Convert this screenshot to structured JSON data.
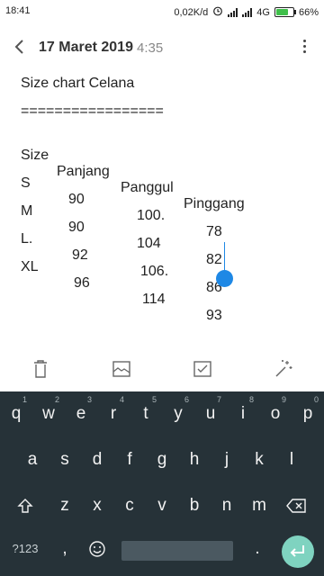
{
  "status_bar": {
    "time": "18:41",
    "network_speed": "0,02K/d",
    "network_type": "4G",
    "battery": "66%",
    "battery_level": 0.66
  },
  "header": {
    "date": "17 Maret 2019",
    "time": "4:35"
  },
  "note": {
    "title": "Size chart Celana",
    "separator": "=================",
    "columns": [
      "Size",
      "Panjang",
      "Panggul",
      "Pinggang"
    ],
    "rows": [
      [
        "S",
        "90",
        "100.",
        "78"
      ],
      [
        "M",
        "90",
        "104",
        "82"
      ],
      [
        "L.",
        "92",
        "106.",
        "86"
      ],
      [
        "XL",
        "96",
        "114",
        "93"
      ]
    ]
  },
  "toolbar": {
    "items": [
      "delete-icon",
      "image-icon",
      "checklist-icon",
      "magic-icon"
    ]
  },
  "keyboard": {
    "row1": [
      {
        "key": "q",
        "hint": "1"
      },
      {
        "key": "w",
        "hint": "2"
      },
      {
        "key": "e",
        "hint": "3"
      },
      {
        "key": "r",
        "hint": "4"
      },
      {
        "key": "t",
        "hint": "5"
      },
      {
        "key": "y",
        "hint": "6"
      },
      {
        "key": "u",
        "hint": "7"
      },
      {
        "key": "i",
        "hint": "8"
      },
      {
        "key": "o",
        "hint": "9"
      },
      {
        "key": "p",
        "hint": "0"
      }
    ],
    "row2": [
      "a",
      "s",
      "d",
      "f",
      "g",
      "h",
      "j",
      "k",
      "l"
    ],
    "row3": [
      "z",
      "x",
      "c",
      "v",
      "b",
      "n",
      "m"
    ],
    "symbols_label": "?123",
    "comma": ",",
    "period": "."
  },
  "colors": {
    "accent": "#1e88e5",
    "keyboard_bg": "#263238",
    "enter_key": "#7fd3c0"
  }
}
